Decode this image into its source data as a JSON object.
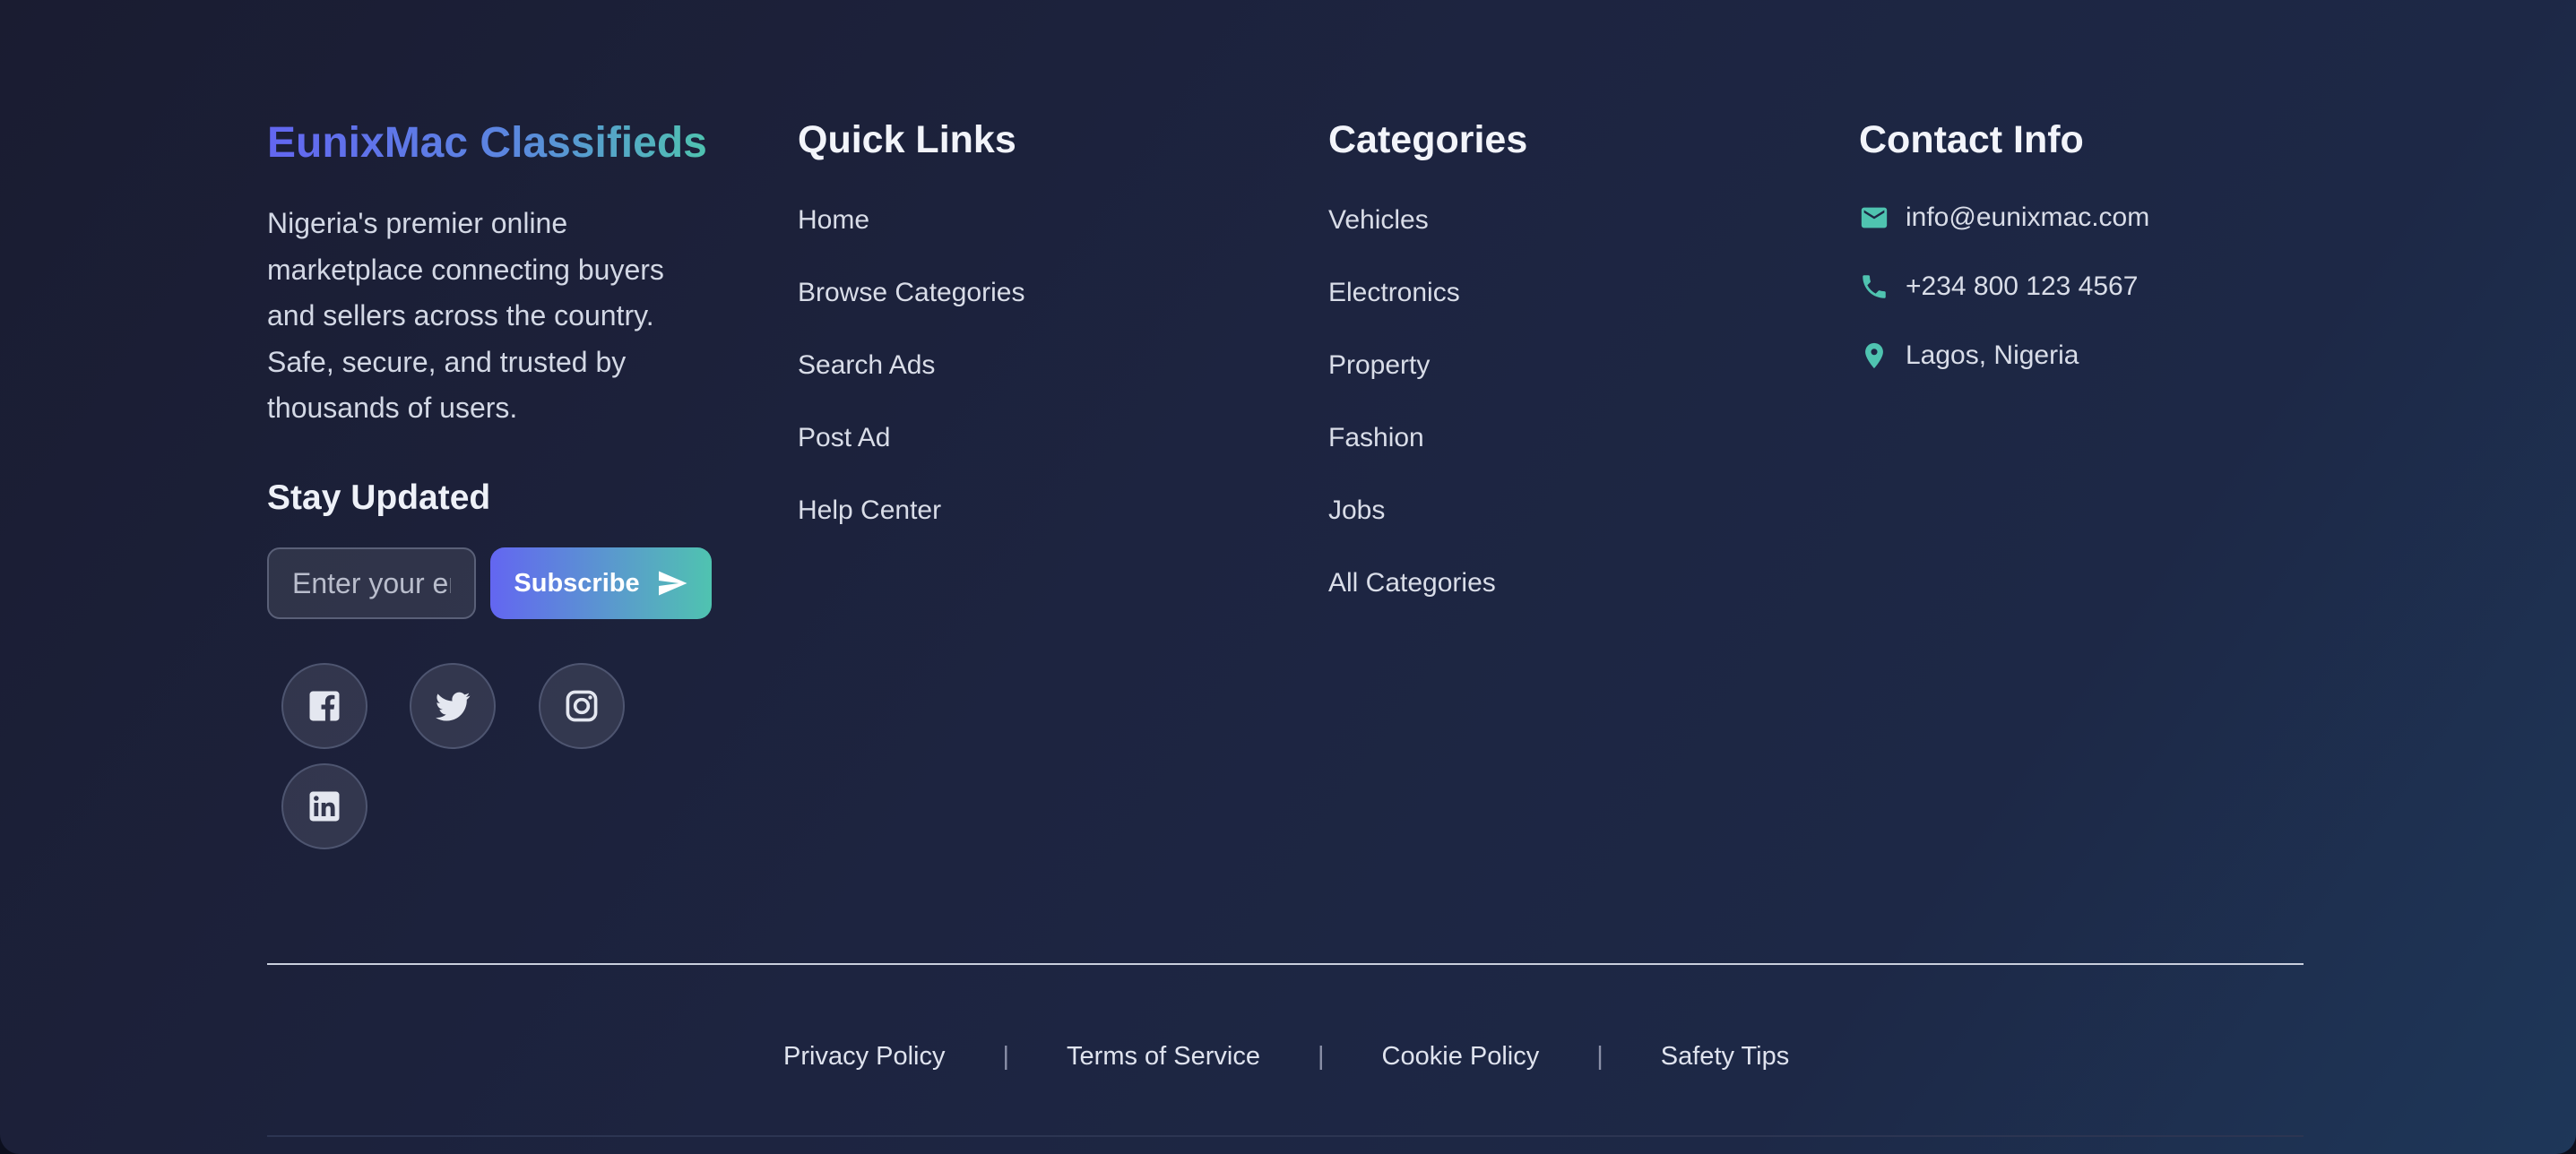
{
  "brand": {
    "title": "EunixMac Classifieds",
    "description": "Nigeria's premier online marketplace connecting buyers and sellers across the country. Safe, secure, and trusted by thousands of users."
  },
  "newsletter": {
    "title": "Stay Updated",
    "placeholder": "Enter your email",
    "button_label": "Subscribe",
    "button_icon": "send-icon"
  },
  "social": {
    "icons": [
      "facebook-icon",
      "twitter-icon",
      "instagram-icon",
      "linkedin-icon"
    ]
  },
  "quick_links": {
    "title": "Quick Links",
    "items": [
      "Home",
      "Browse Categories",
      "Search Ads",
      "Post Ad",
      "Help Center"
    ]
  },
  "categories": {
    "title": "Categories",
    "items": [
      "Vehicles",
      "Electronics",
      "Property",
      "Fashion",
      "Jobs",
      "All Categories"
    ]
  },
  "contact": {
    "title": "Contact Info",
    "email": "info@eunixmac.com",
    "phone": "+234 800 123 4567",
    "location": "Lagos, Nigeria",
    "icon_color": "#4fc3b0"
  },
  "legal": {
    "items": [
      "Privacy Policy",
      "Terms of Service",
      "Cookie Policy",
      "Safety Tips"
    ],
    "separator": "|"
  },
  "colors": {
    "accent_start": "#6366f1",
    "accent_end": "#4fc3b0",
    "background": "#1d2440"
  }
}
